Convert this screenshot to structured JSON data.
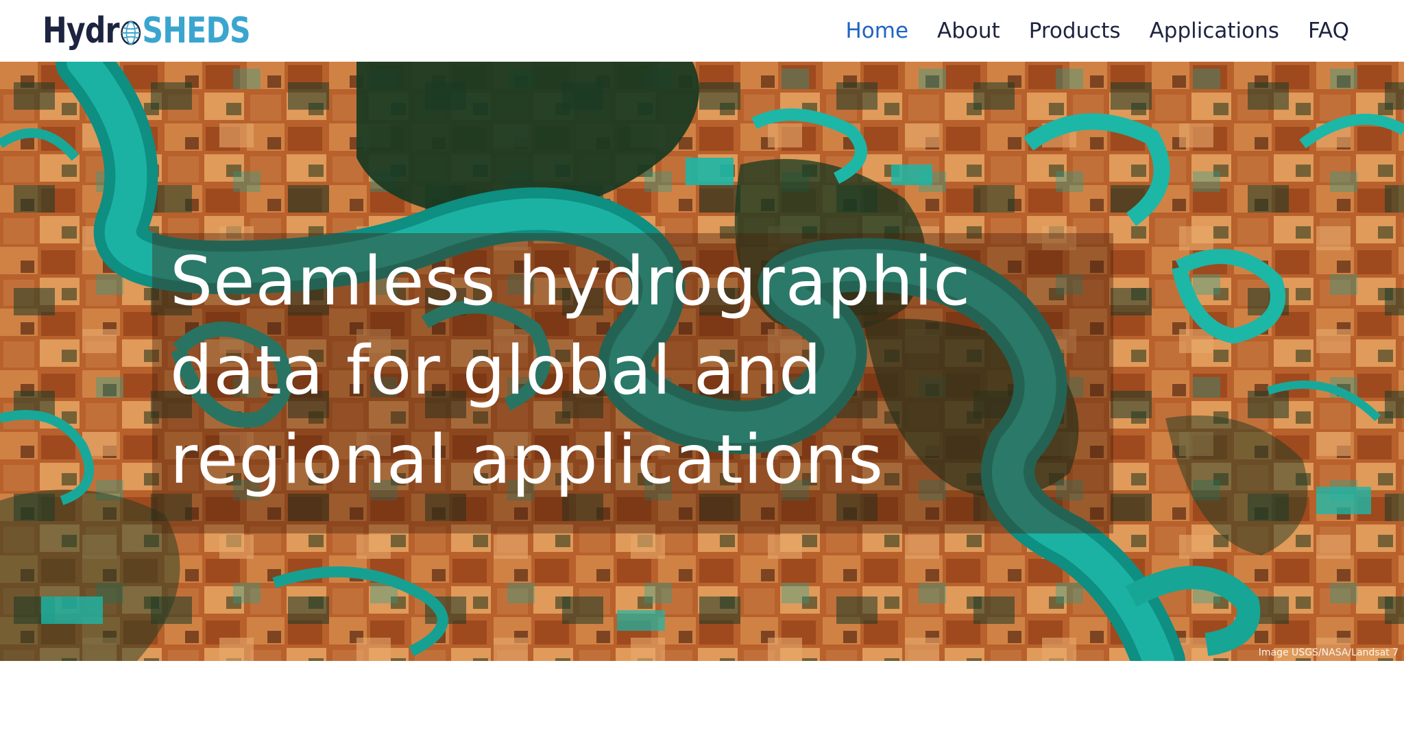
{
  "logo": {
    "part1": "Hydr",
    "part2": "SHEDS",
    "globe_icon": "globe-icon",
    "colors": {
      "dark": "#1d2440",
      "accent": "#3aa5cf"
    }
  },
  "nav": {
    "items": [
      {
        "label": "Home",
        "active": true
      },
      {
        "label": "About",
        "active": false
      },
      {
        "label": "Products",
        "active": false
      },
      {
        "label": "Applications",
        "active": false
      },
      {
        "label": "FAQ",
        "active": false
      }
    ],
    "active_color": "#1f64c4",
    "text_color": "#1d2440"
  },
  "hero": {
    "title_lines": [
      "Seamless hydrographic",
      "data for global and",
      "regional applications"
    ],
    "credit": "Image USGS/NASA/Landsat 7",
    "colors": {
      "land": "#b8612c",
      "water": "#16a89a",
      "vegetation": "#173a22"
    }
  }
}
